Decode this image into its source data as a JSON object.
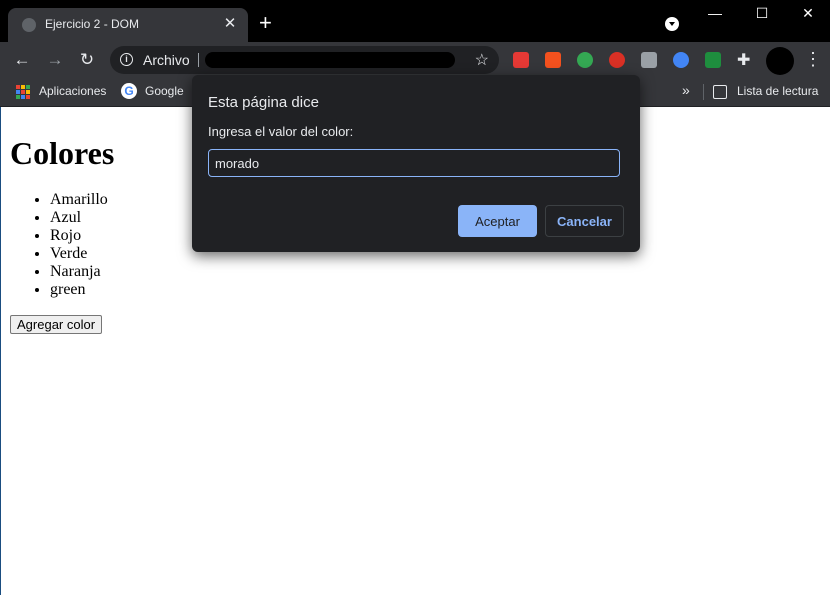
{
  "browser": {
    "tab_title": "Ejercicio 2 - DOM",
    "tab_close": "✕",
    "new_tab": "+",
    "window_controls": {
      "minimize": "—",
      "maximize": "☐",
      "close": "✕"
    },
    "nav": {
      "back": "←",
      "forward": "→",
      "reload": "↻"
    },
    "omnibox_label": "Archivo",
    "bookmarks": {
      "apps": "Aplicaciones",
      "google": "Google",
      "reading_list": "Lista de lectura",
      "overflow": "»"
    },
    "extensions": [
      {
        "name": "ext-red-icon",
        "color": "#e53935"
      },
      {
        "name": "ext-orange-icon",
        "color": "#f4511e"
      },
      {
        "name": "ext-check-icon",
        "color": "#34a853"
      },
      {
        "name": "ext-stop-icon",
        "color": "#d93025"
      },
      {
        "name": "ext-share-icon",
        "color": "#9aa0a6"
      },
      {
        "name": "ext-target-icon",
        "color": "#4285f4"
      },
      {
        "name": "ext-shield-icon",
        "color": "#1e8e3e"
      }
    ]
  },
  "page": {
    "heading": "Colores",
    "colors": [
      "Amarillo",
      "Azul",
      "Rojo",
      "Verde",
      "Naranja",
      "green"
    ],
    "add_button": "Agregar color"
  },
  "dialog": {
    "title": "Esta página dice",
    "message": "Ingresa el valor del color:",
    "input_value": "morado",
    "ok": "Aceptar",
    "cancel": "Cancelar"
  }
}
